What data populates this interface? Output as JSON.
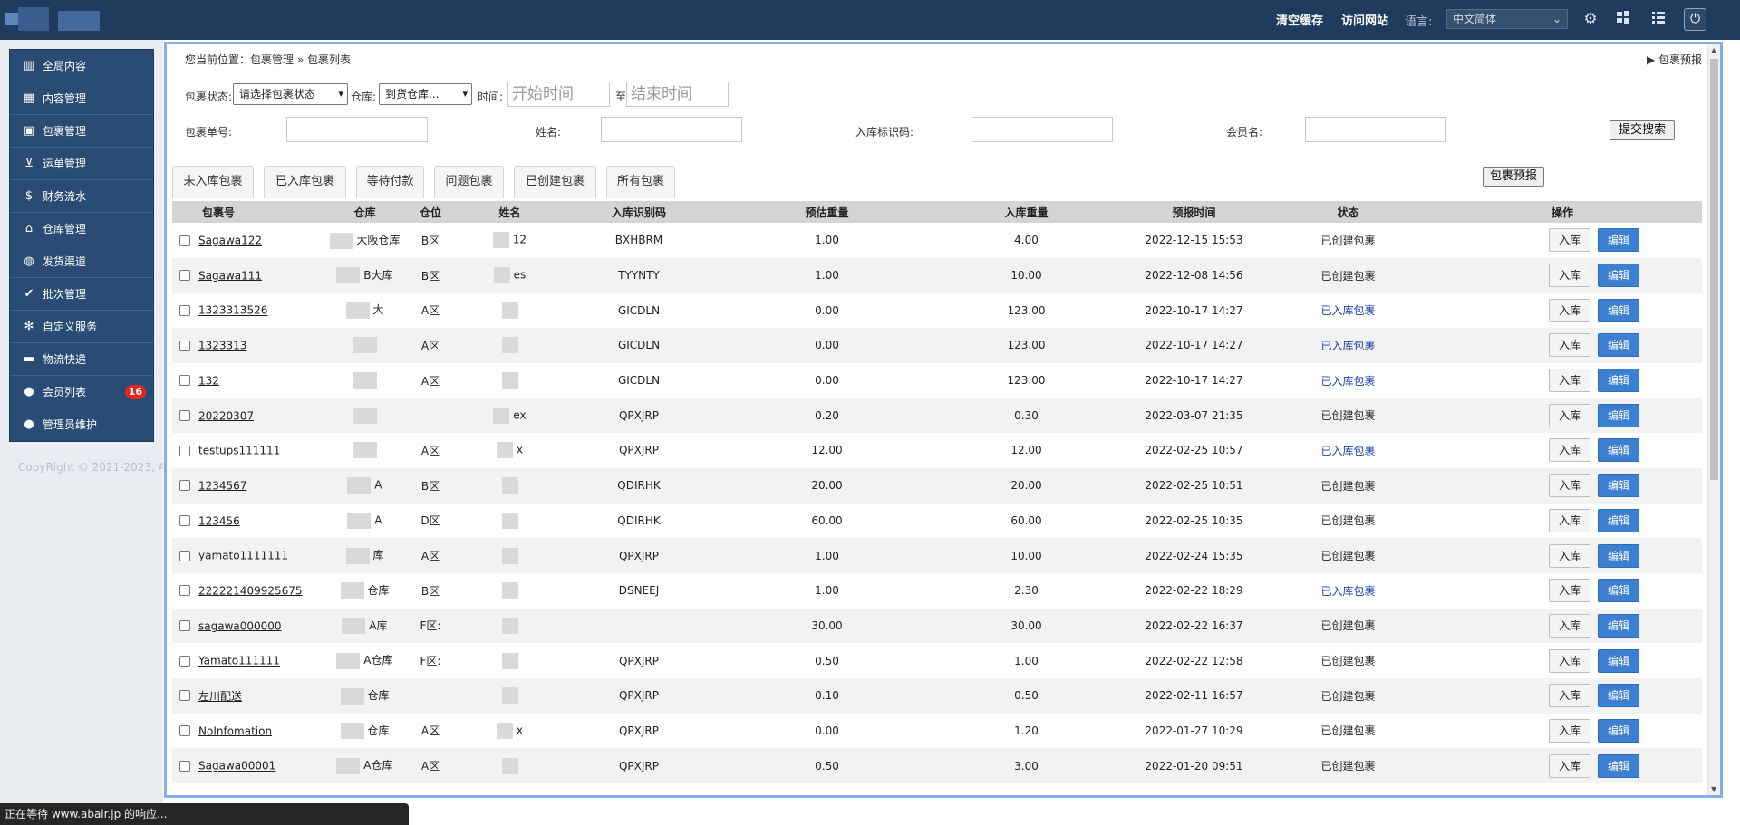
{
  "topbar": {
    "clear_cache": "清空缓存",
    "visit_site": "访问网站",
    "lang_label": "语言:",
    "lang_value": "中文简体"
  },
  "sidebar": {
    "items": [
      {
        "label": "全局内容",
        "icon": "books-icon"
      },
      {
        "label": "内容管理",
        "icon": "building-icon"
      },
      {
        "label": "包裹管理",
        "icon": "briefcase-icon"
      },
      {
        "label": "运单管理",
        "icon": "cart-icon"
      },
      {
        "label": "财务流水",
        "icon": "dollar-icon"
      },
      {
        "label": "仓库管理",
        "icon": "bank-icon"
      },
      {
        "label": "发货渠道",
        "icon": "globe-icon"
      },
      {
        "label": "批次管理",
        "icon": "check-icon"
      },
      {
        "label": "自定义服务",
        "icon": "cog-icon"
      },
      {
        "label": "物流快递",
        "icon": "truck-icon"
      },
      {
        "label": "会员列表",
        "icon": "user-icon",
        "badge": "16"
      },
      {
        "label": "管理员维护",
        "icon": "admin-icon"
      }
    ],
    "copyright": "CopyRight © 2021-2023, A"
  },
  "breadcrumb": "您当前位置：包裹管理 » 包裹列表",
  "preview_link": "包裹预报",
  "filters": {
    "status_label": "包裹状态:",
    "status_value": "请选择包裹状态",
    "warehouse_label": "仓库:",
    "warehouse_value": "到货仓库...",
    "time_label": "时间:",
    "start_placeholder": "开始时间",
    "to": "至",
    "end_placeholder": "结束时间",
    "pkg_no_label": "包裹单号:",
    "name_label": "姓名:",
    "code_label": "入库标识码:",
    "member_label": "会员名:",
    "submit": "提交搜索"
  },
  "tabs": [
    "未入库包裹",
    "已入库包裹",
    "等待付款",
    "问题包裹",
    "已创建包裹",
    "所有包裹"
  ],
  "preview_button": "包裹预报",
  "table": {
    "headers": [
      "包裹号",
      "仓库",
      "仓位",
      "姓名",
      "入库识别码",
      "预估重量",
      "入库重量",
      "预报时间",
      "状态",
      "操作"
    ],
    "rows": [
      {
        "pkg": "Sagawa122",
        "wh": "大阪仓库",
        "bin": "B区",
        "name": "12",
        "code": "BXHBRM",
        "est": "1.00",
        "act": "4.00",
        "time": "2022-12-15 15:53",
        "status": "已创建包裹",
        "in": false
      },
      {
        "pkg": "Sagawa111",
        "wh": "B大库",
        "bin": "B区",
        "name": "es",
        "code": "TYYNTY",
        "est": "1.00",
        "act": "10.00",
        "time": "2022-12-08 14:56",
        "status": "已创建包裹",
        "in": false
      },
      {
        "pkg": "1323313526",
        "wh": "大",
        "bin": "A区",
        "name": "",
        "code": "GICDLN",
        "est": "0.00",
        "act": "123.00",
        "time": "2022-10-17 14:27",
        "status": "已入库包裹",
        "in": true
      },
      {
        "pkg": "1323313",
        "wh": "",
        "bin": "A区",
        "name": "",
        "code": "GICDLN",
        "est": "0.00",
        "act": "123.00",
        "time": "2022-10-17 14:27",
        "status": "已入库包裹",
        "in": true
      },
      {
        "pkg": "132",
        "wh": "",
        "bin": "A区",
        "name": "",
        "code": "GICDLN",
        "est": "0.00",
        "act": "123.00",
        "time": "2022-10-17 14:27",
        "status": "已入库包裹",
        "in": true
      },
      {
        "pkg": "20220307",
        "wh": "",
        "bin": "",
        "name": "ex",
        "code": "QPXJRP",
        "est": "0.20",
        "act": "0.30",
        "time": "2022-03-07 21:35",
        "status": "已创建包裹",
        "in": false
      },
      {
        "pkg": "testups111111",
        "wh": "",
        "bin": "A区",
        "name": "x",
        "code": "QPXJRP",
        "est": "12.00",
        "act": "12.00",
        "time": "2022-02-25 10:57",
        "status": "已入库包裹",
        "in": true
      },
      {
        "pkg": "1234567",
        "wh": "A",
        "bin": "B区",
        "name": "",
        "code": "QDIRHK",
        "est": "20.00",
        "act": "20.00",
        "time": "2022-02-25 10:51",
        "status": "已创建包裹",
        "in": false
      },
      {
        "pkg": "123456",
        "wh": "A",
        "bin": "D区",
        "name": "",
        "code": "QDIRHK",
        "est": "60.00",
        "act": "60.00",
        "time": "2022-02-25 10:35",
        "status": "已创建包裹",
        "in": false
      },
      {
        "pkg": "yamato1111111",
        "wh": "库",
        "bin": "A区",
        "name": "",
        "code": "QPXJRP",
        "est": "1.00",
        "act": "10.00",
        "time": "2022-02-24 15:35",
        "status": "已创建包裹",
        "in": false
      },
      {
        "pkg": "222221409925675",
        "wh": "仓库",
        "bin": "B区",
        "name": "",
        "code": "DSNEEJ",
        "est": "1.00",
        "act": "2.30",
        "time": "2022-02-22 18:29",
        "status": "已入库包裹",
        "in": true
      },
      {
        "pkg": "sagawa000000",
        "wh": "A库",
        "bin": "F区:",
        "name": "",
        "code": "",
        "est": "30.00",
        "act": "30.00",
        "time": "2022-02-22 16:37",
        "status": "已创建包裹",
        "in": false
      },
      {
        "pkg": "Yamato111111",
        "wh": "A仓库",
        "bin": "F区:",
        "name": "",
        "code": "QPXJRP",
        "est": "0.50",
        "act": "1.00",
        "time": "2022-02-22 12:58",
        "status": "已创建包裹",
        "in": false
      },
      {
        "pkg": "左川配送",
        "wh": "仓库",
        "bin": "",
        "name": "",
        "code": "QPXJRP",
        "est": "0.10",
        "act": "0.50",
        "time": "2022-02-11 16:57",
        "status": "已创建包裹",
        "in": false
      },
      {
        "pkg": "NoInfomation",
        "wh": "仓库",
        "bin": "A区",
        "name": "x",
        "code": "QPXJRP",
        "est": "0.00",
        "act": "1.20",
        "time": "2022-01-27 10:29",
        "status": "已创建包裹",
        "in": false
      },
      {
        "pkg": "Sagawa00001",
        "wh": "A仓库",
        "bin": "A区",
        "name": "",
        "code": "QPXJRP",
        "est": "0.50",
        "act": "3.00",
        "time": "2022-01-20 09:51",
        "status": "已创建包裹",
        "in": false
      }
    ],
    "btn_in": "入库",
    "btn_edit": "编辑"
  },
  "statusbar": "正在等待 www.abair.jp 的响应..."
}
